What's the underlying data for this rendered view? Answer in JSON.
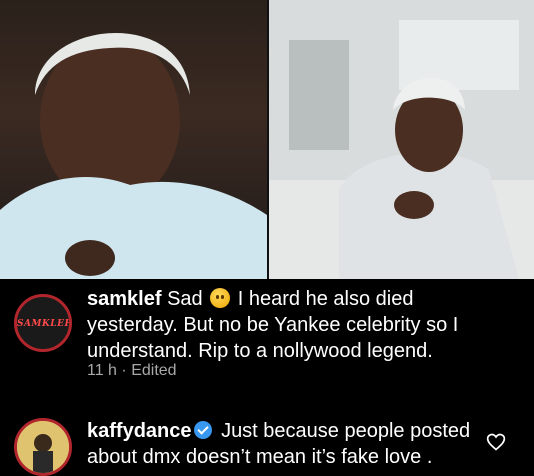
{
  "comments": [
    {
      "username": "samklef",
      "avatar_text": "SAMKLEF",
      "text_before_emoji": "Sad",
      "emoji": "sad-face-emoji",
      "text_after_emoji": "I heard he also died yesterday. But no be Yankee celebrity so I understand. Rip to a nollywood legend.",
      "time": "11 h",
      "edited": "Edited"
    },
    {
      "username": "kaffydance",
      "verified": true,
      "text": "Just because people posted about dmx doesn’t mean it’s fake love ."
    }
  ],
  "colors": {
    "background": "#000000",
    "meta": "#a8a8a8",
    "avatar_ring": "#b1262c",
    "verified": "#3897f0"
  }
}
